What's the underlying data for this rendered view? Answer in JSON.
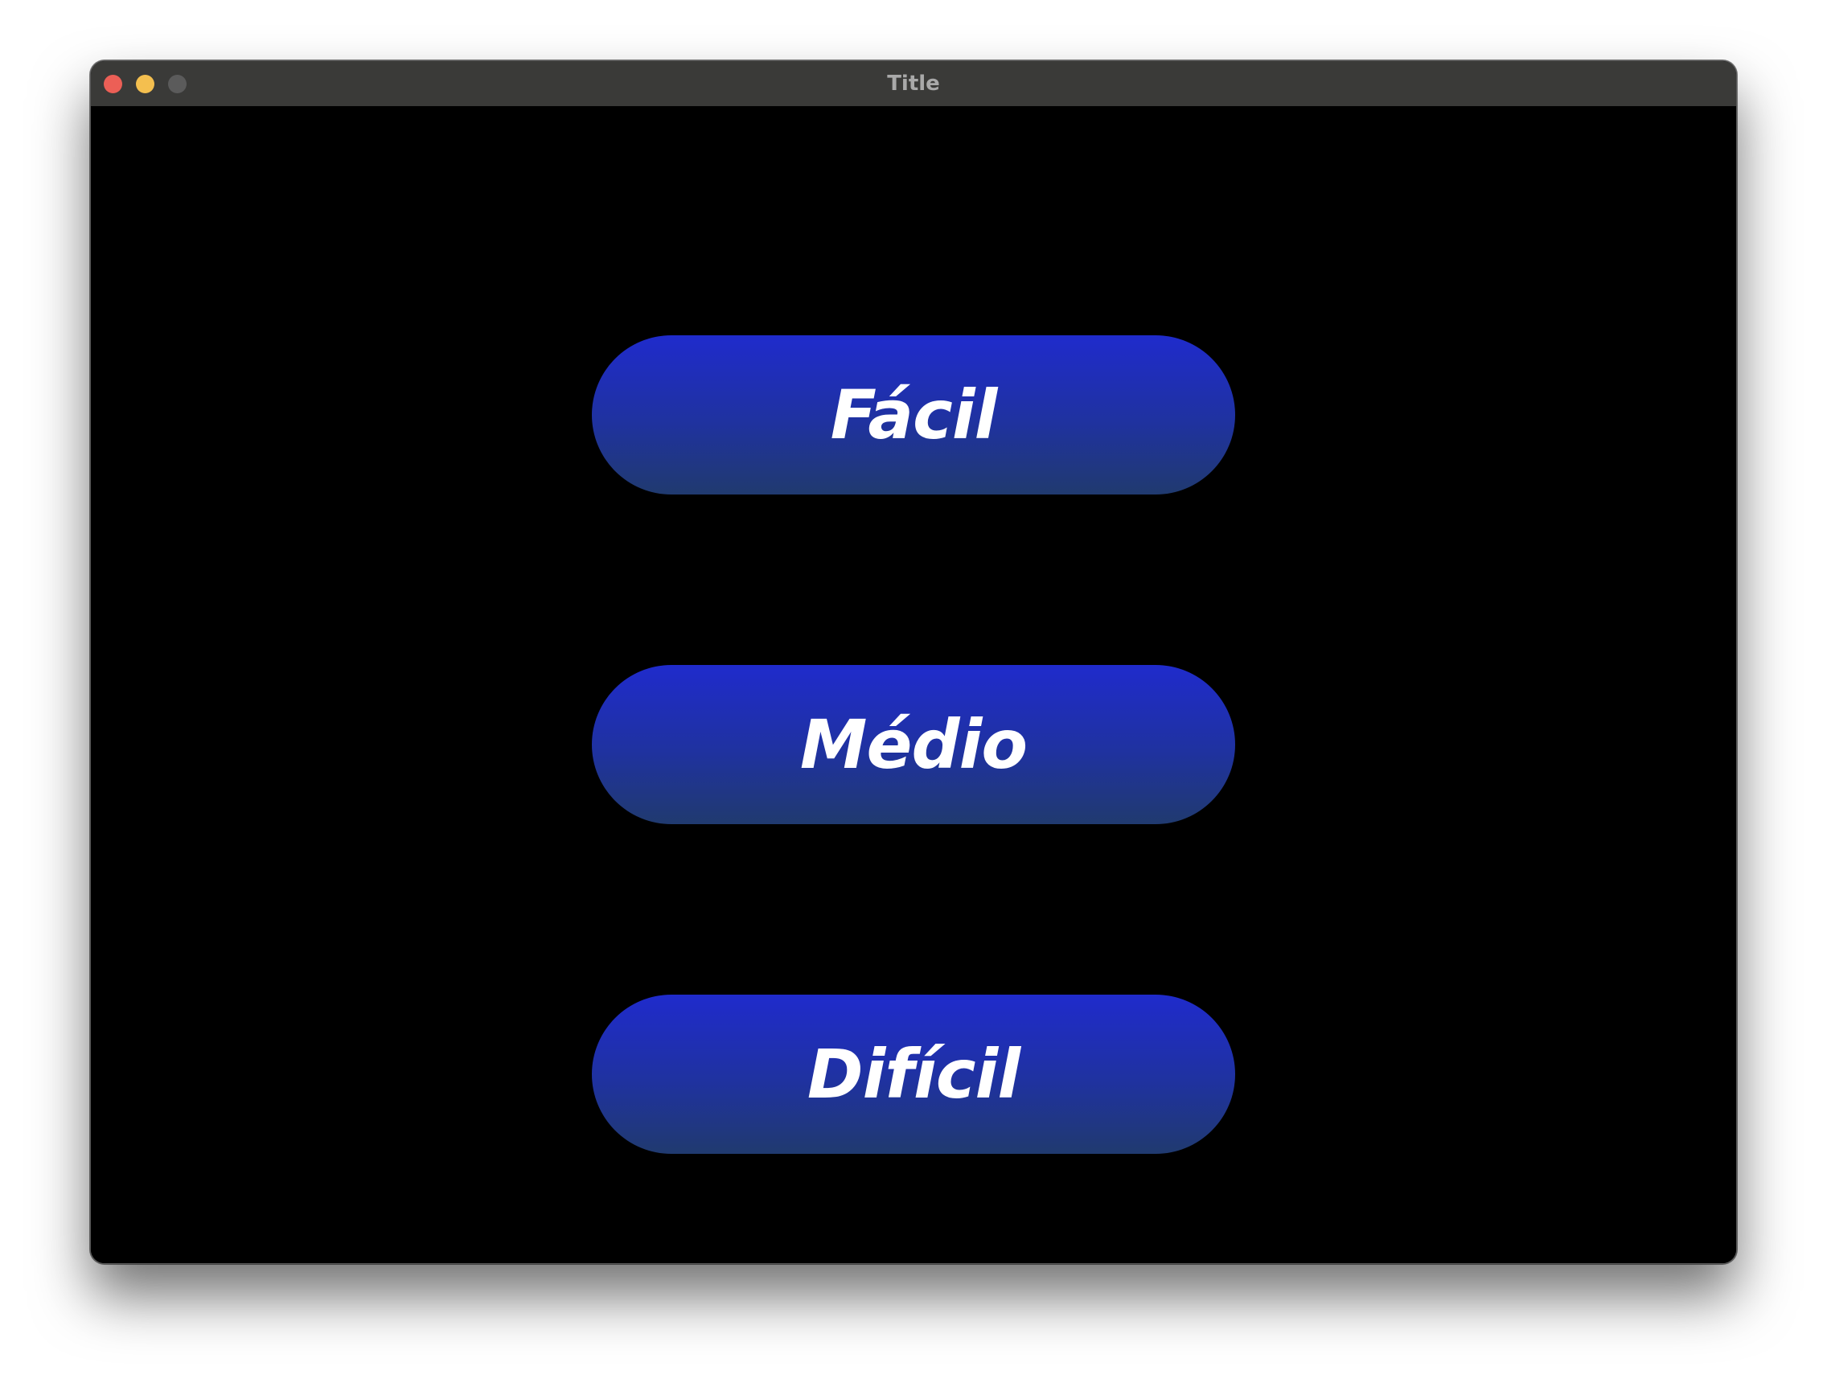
{
  "window": {
    "title": "Title",
    "controls": {
      "close_color": "#ec5f56",
      "minimize_color": "#f4bf4f",
      "zoom_color": "#5b5b5b"
    }
  },
  "menu": {
    "buttons": [
      {
        "label": "Fácil"
      },
      {
        "label": "Médio"
      },
      {
        "label": "Difícil"
      }
    ]
  },
  "colors": {
    "background": "#000000",
    "button_top": "#1f2bcc",
    "button_bottom": "#203a6f",
    "button_text": "#ffffff"
  }
}
